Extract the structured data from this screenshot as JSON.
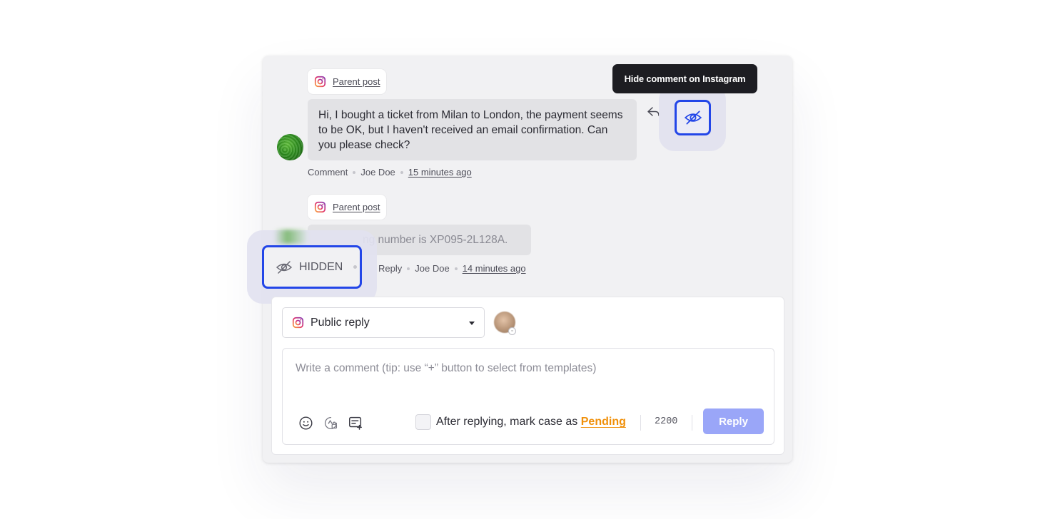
{
  "thread": [
    {
      "parent_label": "Parent post",
      "message": "Hi, I bought a ticket from Milan to London, the payment seems to be OK, but I haven't received an email confirmation. Can you please check?",
      "type": "Comment",
      "author": "Joe Doe",
      "time": "15 minutes ago"
    },
    {
      "parent_label": "Parent post",
      "message": "ng number is XP095-2L128A.",
      "status": "HIDDEN",
      "type": "Reply",
      "author": "Joe Doe",
      "time": "14 minutes ago"
    }
  ],
  "tooltip": "Hide comment on Instagram",
  "icons": {
    "platform": "instagram-icon",
    "reply": "reply-arrow-icon",
    "hide": "eye-off-icon",
    "emoji": "emoji-icon",
    "ai": "ai-assist-icon",
    "templates": "templates-icon"
  },
  "composer": {
    "reply_type": "Public reply",
    "placeholder": "Write a comment (tip: use “+” button to select from templates)",
    "mark_label": "After replying, mark case as",
    "mark_status": "Pending",
    "char_count": "2200",
    "reply_button": "Reply"
  },
  "colors": {
    "accent": "#2346e8",
    "pending": "#f0900a",
    "reply_button": "#9aa6f8",
    "tooltip_bg": "#1d1d22"
  }
}
